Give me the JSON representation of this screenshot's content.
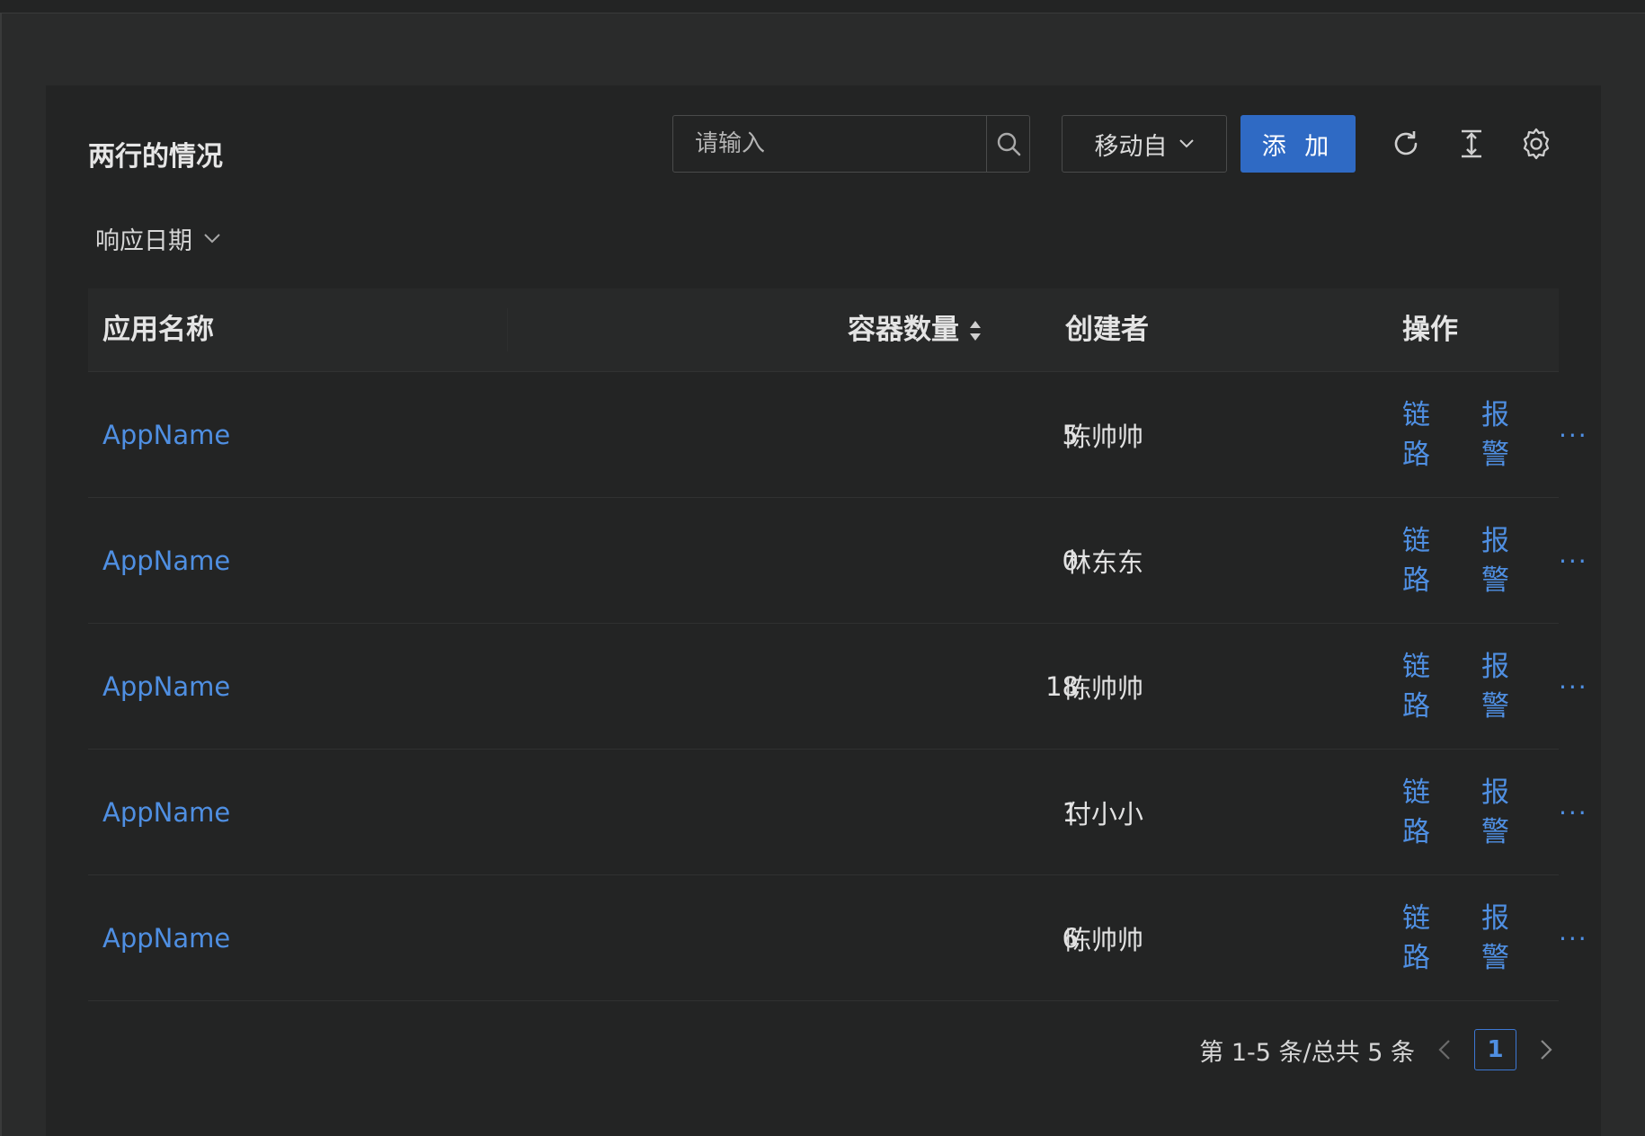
{
  "card": {
    "title": "两行的情况",
    "search": {
      "placeholder": "请输入"
    },
    "select_label": "移动自",
    "add_label": "添 加",
    "filter_label": "响应日期"
  },
  "table": {
    "columns": {
      "name": "应用名称",
      "count": "容器数量",
      "creator": "创建者",
      "actions": "操作"
    },
    "action_labels": {
      "trace_top": "链",
      "trace_bottom": "路",
      "alarm_top": "报",
      "alarm_bottom": "警",
      "more": "···"
    },
    "rows": [
      {
        "name": "AppName",
        "count": "5",
        "creator": "陈帅帅"
      },
      {
        "name": "AppName",
        "count": "0",
        "creator": "林东东"
      },
      {
        "name": "AppName",
        "count": "18",
        "creator": "陈帅帅"
      },
      {
        "name": "AppName",
        "count": "1",
        "creator": "付小小"
      },
      {
        "name": "AppName",
        "count": "6",
        "creator": "陈帅帅"
      }
    ]
  },
  "pagination": {
    "summary": "第 1-5 条/总共 5 条",
    "current_page": "1"
  },
  "colors": {
    "primary": "#2f6ac4",
    "link": "#4f8fe2",
    "background": "#232424"
  },
  "icons": [
    "search-icon",
    "chevron-down-icon",
    "refresh-icon",
    "column-height-icon",
    "gear-icon",
    "sort-icon",
    "chevron-left-icon",
    "chevron-right-icon"
  ]
}
